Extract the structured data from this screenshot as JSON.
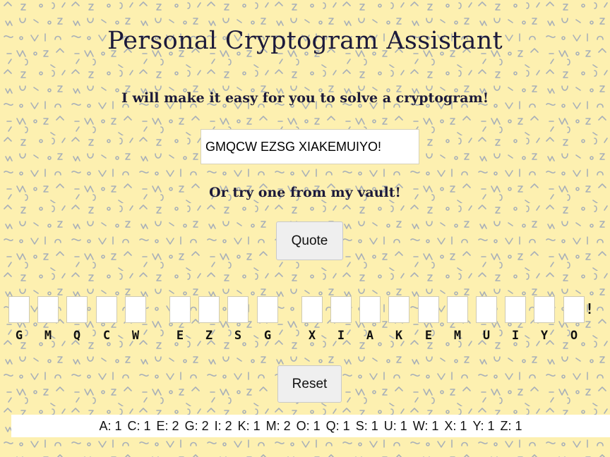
{
  "header": {
    "title": "Personal Cryptogram Assistant",
    "subtitle": "I will make it easy for you to solve a cryptogram!"
  },
  "cipher_input": {
    "value": "GMQCW EZSG XIAKEMUIYO!"
  },
  "vault": {
    "text": "Or try one from my vault!",
    "quote_button": "Quote"
  },
  "puzzle": {
    "words": [
      [
        "G",
        "M",
        "Q",
        "C",
        "W"
      ],
      [
        "E",
        "Z",
        "S",
        "G"
      ],
      [
        "X",
        "I",
        "A",
        "K",
        "E",
        "M",
        "U",
        "I",
        "Y",
        "O"
      ]
    ],
    "trailing_punct": "!"
  },
  "reset_button": "Reset",
  "frequencies": [
    {
      "letter": "A",
      "count": 1
    },
    {
      "letter": "C",
      "count": 1
    },
    {
      "letter": "E",
      "count": 2
    },
    {
      "letter": "G",
      "count": 2
    },
    {
      "letter": "I",
      "count": 2
    },
    {
      "letter": "K",
      "count": 1
    },
    {
      "letter": "M",
      "count": 2
    },
    {
      "letter": "O",
      "count": 1
    },
    {
      "letter": "Q",
      "count": 1
    },
    {
      "letter": "S",
      "count": 1
    },
    {
      "letter": "U",
      "count": 1
    },
    {
      "letter": "W",
      "count": 1
    },
    {
      "letter": "X",
      "count": 1
    },
    {
      "letter": "Y",
      "count": 1
    },
    {
      "letter": "Z",
      "count": 1
    }
  ],
  "colors": {
    "background": "#fdf0b0",
    "pattern": "#a8b0b8",
    "title": "#1c1a3a"
  }
}
